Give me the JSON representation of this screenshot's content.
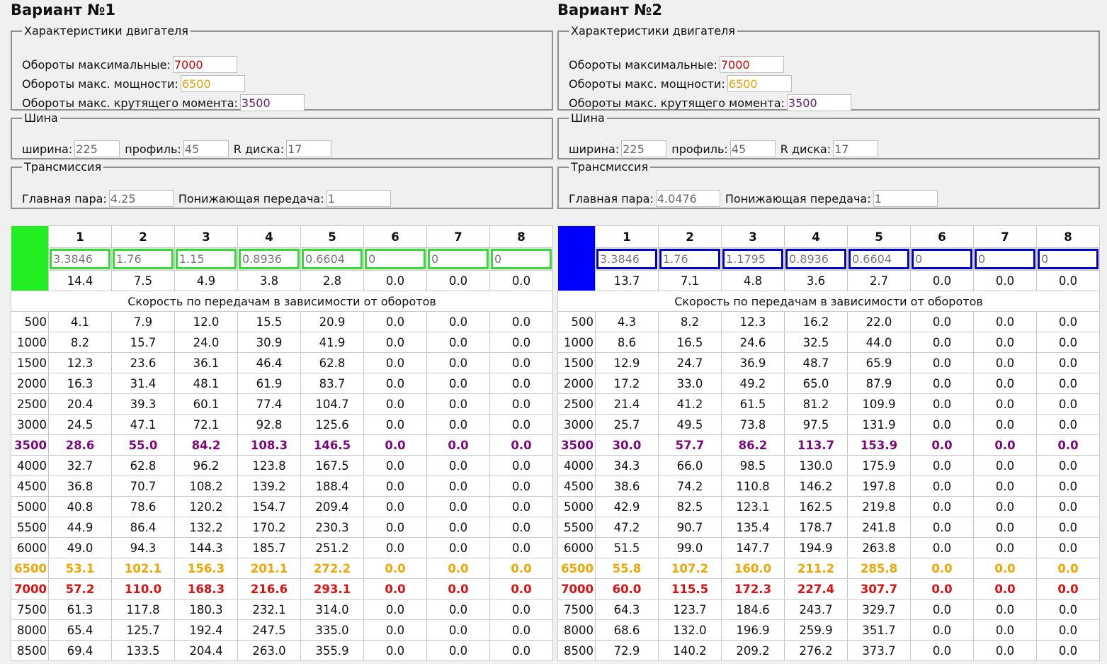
{
  "colors": {
    "variant1_accent": "#22ee22",
    "variant2_accent": "#0000ff",
    "max_rpm": "#dd1111",
    "power_rpm": "#f0a500",
    "torque_rpm": "#7a0a7a"
  },
  "variants": [
    {
      "title": "Вариант №1",
      "engine": {
        "legend": "Характеристики двигателя",
        "max_rpm_label": "Обороты максимальные:",
        "max_rpm": "7000",
        "power_rpm_label": "Обороты макс. мощности:",
        "power_rpm": "6500",
        "torque_rpm_label": "Обороты макс. крутящего момента:",
        "torque_rpm": "3500"
      },
      "tire": {
        "legend": "Шина",
        "width_label": "ширина:",
        "width": "225",
        "profile_label": "профиль:",
        "profile": "45",
        "rim_label": "R диска:",
        "rim": "17"
      },
      "transmission": {
        "legend": "Трансмиссия",
        "main_pair_label": "Главная пара:",
        "main_pair": "4.25",
        "reduction_label": "Понижающая передача:",
        "reduction": "1"
      },
      "gear_numbers": [
        "1",
        "2",
        "3",
        "4",
        "5",
        "6",
        "7",
        "8"
      ],
      "gear_ratios": [
        "3.3846",
        "1.76",
        "1.15",
        "0.8936",
        "0.6604",
        "0",
        "0",
        "0"
      ],
      "gear_steps": [
        "14.4",
        "7.5",
        "4.9",
        "3.8",
        "2.8",
        "0.0",
        "0.0",
        "0.0"
      ],
      "section_title": "Скорость по передачам в зависимости от оборотов",
      "speed_rows": [
        {
          "rpm": "500",
          "v": [
            "4.1",
            "7.9",
            "12.0",
            "15.5",
            "20.9",
            "0.0",
            "0.0",
            "0.0"
          ]
        },
        {
          "rpm": "1000",
          "v": [
            "8.2",
            "15.7",
            "24.0",
            "30.9",
            "41.9",
            "0.0",
            "0.0",
            "0.0"
          ]
        },
        {
          "rpm": "1500",
          "v": [
            "12.3",
            "23.6",
            "36.1",
            "46.4",
            "62.8",
            "0.0",
            "0.0",
            "0.0"
          ]
        },
        {
          "rpm": "2000",
          "v": [
            "16.3",
            "31.4",
            "48.1",
            "61.9",
            "83.7",
            "0.0",
            "0.0",
            "0.0"
          ]
        },
        {
          "rpm": "2500",
          "v": [
            "20.4",
            "39.3",
            "60.1",
            "77.4",
            "104.7",
            "0.0",
            "0.0",
            "0.0"
          ]
        },
        {
          "rpm": "3000",
          "v": [
            "24.5",
            "47.1",
            "72.1",
            "92.8",
            "125.6",
            "0.0",
            "0.0",
            "0.0"
          ]
        },
        {
          "rpm": "3500",
          "v": [
            "28.6",
            "55.0",
            "84.2",
            "108.3",
            "146.5",
            "0.0",
            "0.0",
            "0.0"
          ]
        },
        {
          "rpm": "4000",
          "v": [
            "32.7",
            "62.8",
            "96.2",
            "123.8",
            "167.5",
            "0.0",
            "0.0",
            "0.0"
          ]
        },
        {
          "rpm": "4500",
          "v": [
            "36.8",
            "70.7",
            "108.2",
            "139.2",
            "188.4",
            "0.0",
            "0.0",
            "0.0"
          ]
        },
        {
          "rpm": "5000",
          "v": [
            "40.8",
            "78.6",
            "120.2",
            "154.7",
            "209.4",
            "0.0",
            "0.0",
            "0.0"
          ]
        },
        {
          "rpm": "5500",
          "v": [
            "44.9",
            "86.4",
            "132.2",
            "170.2",
            "230.3",
            "0.0",
            "0.0",
            "0.0"
          ]
        },
        {
          "rpm": "6000",
          "v": [
            "49.0",
            "94.3",
            "144.3",
            "185.7",
            "251.2",
            "0.0",
            "0.0",
            "0.0"
          ]
        },
        {
          "rpm": "6500",
          "v": [
            "53.1",
            "102.1",
            "156.3",
            "201.1",
            "272.2",
            "0.0",
            "0.0",
            "0.0"
          ]
        },
        {
          "rpm": "7000",
          "v": [
            "57.2",
            "110.0",
            "168.3",
            "216.6",
            "293.1",
            "0.0",
            "0.0",
            "0.0"
          ]
        },
        {
          "rpm": "7500",
          "v": [
            "61.3",
            "117.8",
            "180.3",
            "232.1",
            "314.0",
            "0.0",
            "0.0",
            "0.0"
          ]
        },
        {
          "rpm": "8000",
          "v": [
            "65.4",
            "125.7",
            "192.4",
            "247.5",
            "335.0",
            "0.0",
            "0.0",
            "0.0"
          ]
        },
        {
          "rpm": "8500",
          "v": [
            "69.4",
            "133.5",
            "204.4",
            "263.0",
            "355.9",
            "0.0",
            "0.0",
            "0.0"
          ]
        }
      ]
    },
    {
      "title": "Вариант №2",
      "engine": {
        "legend": "Характеристики двигателя",
        "max_rpm_label": "Обороты максимальные:",
        "max_rpm": "7000",
        "power_rpm_label": "Обороты макс. мощности:",
        "power_rpm": "6500",
        "torque_rpm_label": "Обороты макс. крутящего момента:",
        "torque_rpm": "3500"
      },
      "tire": {
        "legend": "Шина",
        "width_label": "ширина:",
        "width": "225",
        "profile_label": "профиль:",
        "profile": "45",
        "rim_label": "R диска:",
        "rim": "17"
      },
      "transmission": {
        "legend": "Трансмиссия",
        "main_pair_label": "Главная пара:",
        "main_pair": "4.0476",
        "reduction_label": "Понижающая передача:",
        "reduction": "1"
      },
      "gear_numbers": [
        "1",
        "2",
        "3",
        "4",
        "5",
        "6",
        "7",
        "8"
      ],
      "gear_ratios": [
        "3.3846",
        "1.76",
        "1.1795",
        "0.8936",
        "0.6604",
        "0",
        "0",
        "0"
      ],
      "gear_steps": [
        "13.7",
        "7.1",
        "4.8",
        "3.6",
        "2.7",
        "0.0",
        "0.0",
        "0.0"
      ],
      "section_title": "Скорость по передачам в зависимости от оборотов",
      "speed_rows": [
        {
          "rpm": "500",
          "v": [
            "4.3",
            "8.2",
            "12.3",
            "16.2",
            "22.0",
            "0.0",
            "0.0",
            "0.0"
          ]
        },
        {
          "rpm": "1000",
          "v": [
            "8.6",
            "16.5",
            "24.6",
            "32.5",
            "44.0",
            "0.0",
            "0.0",
            "0.0"
          ]
        },
        {
          "rpm": "1500",
          "v": [
            "12.9",
            "24.7",
            "36.9",
            "48.7",
            "65.9",
            "0.0",
            "0.0",
            "0.0"
          ]
        },
        {
          "rpm": "2000",
          "v": [
            "17.2",
            "33.0",
            "49.2",
            "65.0",
            "87.9",
            "0.0",
            "0.0",
            "0.0"
          ]
        },
        {
          "rpm": "2500",
          "v": [
            "21.4",
            "41.2",
            "61.5",
            "81.2",
            "109.9",
            "0.0",
            "0.0",
            "0.0"
          ]
        },
        {
          "rpm": "3000",
          "v": [
            "25.7",
            "49.5",
            "73.8",
            "97.5",
            "131.9",
            "0.0",
            "0.0",
            "0.0"
          ]
        },
        {
          "rpm": "3500",
          "v": [
            "30.0",
            "57.7",
            "86.2",
            "113.7",
            "153.9",
            "0.0",
            "0.0",
            "0.0"
          ]
        },
        {
          "rpm": "4000",
          "v": [
            "34.3",
            "66.0",
            "98.5",
            "130.0",
            "175.9",
            "0.0",
            "0.0",
            "0.0"
          ]
        },
        {
          "rpm": "4500",
          "v": [
            "38.6",
            "74.2",
            "110.8",
            "146.2",
            "197.8",
            "0.0",
            "0.0",
            "0.0"
          ]
        },
        {
          "rpm": "5000",
          "v": [
            "42.9",
            "82.5",
            "123.1",
            "162.5",
            "219.8",
            "0.0",
            "0.0",
            "0.0"
          ]
        },
        {
          "rpm": "5500",
          "v": [
            "47.2",
            "90.7",
            "135.4",
            "178.7",
            "241.8",
            "0.0",
            "0.0",
            "0.0"
          ]
        },
        {
          "rpm": "6000",
          "v": [
            "51.5",
            "99.0",
            "147.7",
            "194.9",
            "263.8",
            "0.0",
            "0.0",
            "0.0"
          ]
        },
        {
          "rpm": "6500",
          "v": [
            "55.8",
            "107.2",
            "160.0",
            "211.2",
            "285.8",
            "0.0",
            "0.0",
            "0.0"
          ]
        },
        {
          "rpm": "7000",
          "v": [
            "60.0",
            "115.5",
            "172.3",
            "227.4",
            "307.7",
            "0.0",
            "0.0",
            "0.0"
          ]
        },
        {
          "rpm": "7500",
          "v": [
            "64.3",
            "123.7",
            "184.6",
            "243.7",
            "329.7",
            "0.0",
            "0.0",
            "0.0"
          ]
        },
        {
          "rpm": "8000",
          "v": [
            "68.6",
            "132.0",
            "196.9",
            "259.9",
            "351.7",
            "0.0",
            "0.0",
            "0.0"
          ]
        },
        {
          "rpm": "8500",
          "v": [
            "72.9",
            "140.2",
            "209.2",
            "276.2",
            "373.7",
            "0.0",
            "0.0",
            "0.0"
          ]
        }
      ]
    }
  ]
}
